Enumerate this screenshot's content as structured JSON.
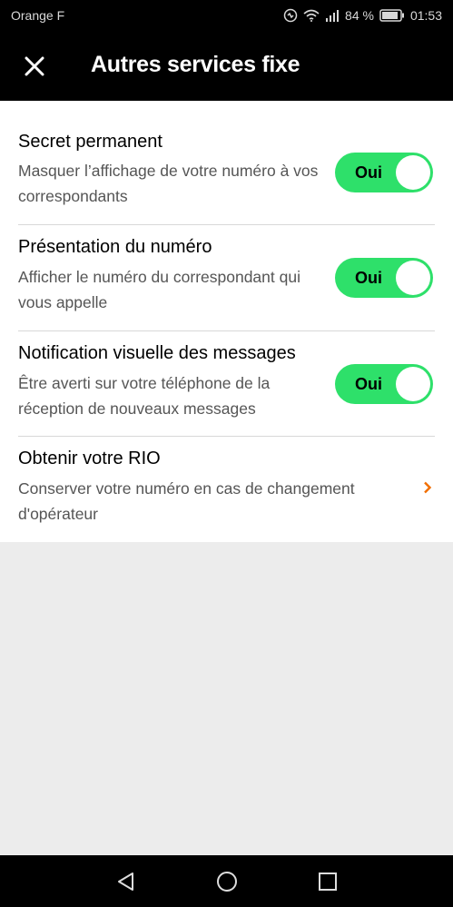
{
  "status": {
    "carrier": "Orange F",
    "battery": "84 %",
    "time": "01:53"
  },
  "header": {
    "title": "Autres services fixe"
  },
  "settings": [
    {
      "title": "Secret permanent",
      "desc": "Masquer l’affichage de votre numéro à vos correspondants",
      "toggle": "Oui"
    },
    {
      "title": "Présentation du numéro",
      "desc": "Afficher le numéro du correspondant qui vous appelle",
      "toggle": "Oui"
    },
    {
      "title": "Notification visuelle des messages",
      "desc": "Être averti sur votre téléphone de la réception de nouveaux messages",
      "toggle": "Oui"
    },
    {
      "title": "Obtenir votre RIO",
      "desc": "Conserver votre numéro en cas de changement d'opérateur"
    }
  ],
  "colors": {
    "toggle_on": "#2ee06a",
    "chevron": "#f16e00"
  },
  "icons": [
    "close-icon",
    "chevron-right-icon",
    "back-icon",
    "home-icon",
    "recents-icon"
  ]
}
